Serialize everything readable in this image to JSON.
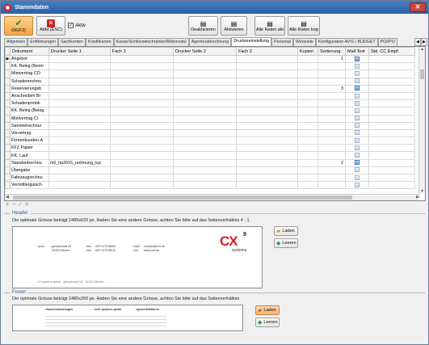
{
  "window": {
    "title": "Stammdaten",
    "close_glyph": "✕"
  },
  "toolbar": {
    "ok_label": "OK(F2)",
    "cancel_label": "Abbr.(ESC)",
    "active_label": "Aktiv",
    "active_checked": true,
    "deactivate_label": "Deaktivieren",
    "activate_label": "Aktivieren",
    "all_rates_current_label": "Alle Raten akt",
    "all_rates_copy_label": "Alle Raten kop"
  },
  "tabs": [
    "Allgemein",
    "Entfernungen",
    "Sachkonten",
    "Kreditkarten",
    "Kasse/Schlüsselschränke/Webmodul",
    "Agenturabrechnung",
    "Druckereinstellung",
    "Personal",
    "Webseite",
    "Konfiguration AVIS / BUDGET",
    "POI/PO"
  ],
  "active_tab_index": 6,
  "grid": {
    "columns": [
      "Dokument",
      "Drucker Seite 1",
      "Fach 1",
      "Drucker Seite 2",
      "Fach 2",
      "Kopien",
      "Sortierung",
      "Mail Text",
      "Std. CC Empf."
    ],
    "rows": [
      {
        "dokument": "Angebot",
        "drucker1": "",
        "sortierung": "1",
        "mail": true,
        "current": true
      },
      {
        "dokument": "KK. Beleg (Norm",
        "drucker1": "",
        "sortierung": "",
        "mail": false
      },
      {
        "dokument": "Mietvertrag CO",
        "drucker1": "",
        "sortierung": "",
        "mail": false
      },
      {
        "dokument": "Schadenrechnu",
        "drucker1": "",
        "sortierung": "",
        "mail": false
      },
      {
        "dokument": "Reservierungsb",
        "drucker1": "",
        "sortierung": "3",
        "mail": true
      },
      {
        "dokument": "Anschreiben Br",
        "drucker1": "",
        "sortierung": "",
        "mail": false
      },
      {
        "dokument": "Schadenprotok",
        "drucker1": "",
        "sortierung": "",
        "mail": false
      },
      {
        "dokument": "KK. Beleg (Beleg",
        "drucker1": "",
        "sortierung": "",
        "mail": false
      },
      {
        "dokument": "Mietvertrag Cl",
        "drucker1": "",
        "sortierung": "",
        "mail": false
      },
      {
        "dokument": "Sammelrechnur",
        "drucker1": "",
        "sortierung": "",
        "mail": false
      },
      {
        "dokument": "Vorvertrag",
        "drucker1": "",
        "sortierung": "",
        "mail": false
      },
      {
        "dokument": "Firmenkunden-A",
        "drucker1": "",
        "sortierung": "",
        "mail": false
      },
      {
        "dokument": "KFZ Papier",
        "drucker1": "",
        "sortierung": "",
        "mail": false
      },
      {
        "dokument": "KK. Lauf",
        "drucker1": "",
        "sortierung": "",
        "mail": false
      },
      {
        "dokument": "Standardrechnu",
        "drucker1": "m0_hp2015_rechnung_tcp",
        "sortierung": "2",
        "mail": true
      },
      {
        "dokument": "Übergabe",
        "drucker1": "",
        "sortierung": "",
        "mail": false
      },
      {
        "dokument": "Fahrzeugrechnu",
        "drucker1": "",
        "sortierung": "",
        "mail": false
      },
      {
        "dokument": "Vermittlergutsch",
        "drucker1": "",
        "sortierung": "",
        "mail": false
      }
    ],
    "current_row_glyph": "▶"
  },
  "navigator": [
    "+",
    "−",
    "✓",
    "✕"
  ],
  "header_section": {
    "label": "Header",
    "hint": "Die optimale Grösse beträgt 2480x620 px. Haben Sie eine andere Grösse, achten Sie bitte auf das Seitenverhältnis 4 : 1.",
    "load_label": "Laden",
    "clear_label": "Leeren",
    "preview": {
      "post_label": ">post",
      "post_lines": [
        "grimpenweil 26",
        "32423 Minden"
      ],
      "fon_label": ">fon",
      "fon_value": "0571-97218000",
      "fax_label": ">fax",
      "fax_value": "0571-97218010",
      "mail_label": ">mail",
      "mail_value": "contact@cx9.de",
      "net_label": ">net",
      "net_value": "www.cx9.de",
      "logo_text": "CX",
      "logo_super": "9",
      "logo_sub": "systems",
      "footer_line": "CX systems gmbh · grimpenweil 26 · 32423 Minden"
    }
  },
  "footer_section": {
    "label": "Footer",
    "hint": "Die optimale Grösse beträgt 2480x260 px. Haben Sie eine andere Grösse, achten Sie bitte auf das Seitenverhältnis",
    "load_label": "Laden",
    "clear_label": "Leeren",
    "preview": {
      "col1_title": ">bankverbindungen",
      "col2_title": ">cx9 systems gmbh",
      "col3_title": ">geschäftsführer"
    }
  },
  "colors": {
    "accent": "#2c5ea6",
    "ok_button": "#f2a64a",
    "logo_red": "#d32027"
  }
}
